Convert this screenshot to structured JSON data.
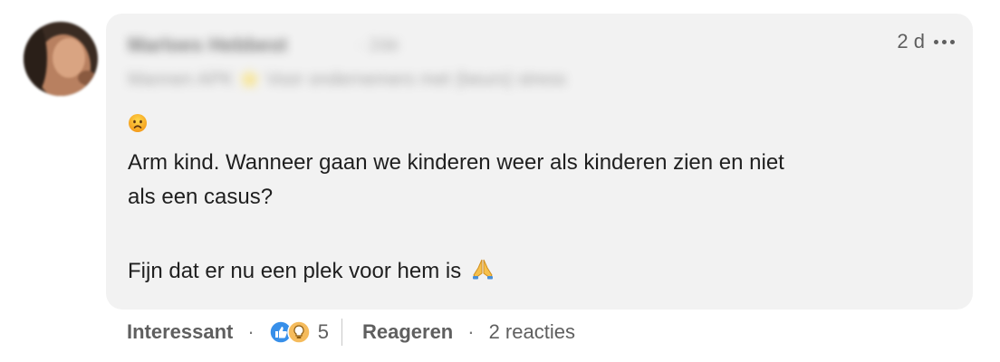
{
  "comment": {
    "author": {
      "name": "Marloes Hebbest",
      "degree": "· 2de",
      "headline": "Mannen APK ⭐ Voor ondernemers met (beurs) stress"
    },
    "timestamp": "2 d",
    "body": {
      "emoji": "sad-face",
      "line1": "Arm kind. Wanneer gaan we kinderen weer als kinderen zien en niet",
      "line2": "als een casus?",
      "line3": "Fijn dat er nu een plek voor hem is"
    }
  },
  "actions": {
    "react_label": "Interessant",
    "separator": "·",
    "reaction_count": "5",
    "reply_label": "Reageren",
    "replies_count_label": "2 reacties"
  },
  "colors": {
    "bubble_bg": "#f2f2f2",
    "text": "#1f1f1f",
    "muted": "#5f5f5f",
    "like_blue": "#378fe9",
    "insight_yellow": "#f5bb5c"
  },
  "icons": [
    "avatar",
    "more-options-icon",
    "sad-face-emoji",
    "praying-hands-emoji",
    "like-reaction-icon",
    "insightful-reaction-icon"
  ]
}
